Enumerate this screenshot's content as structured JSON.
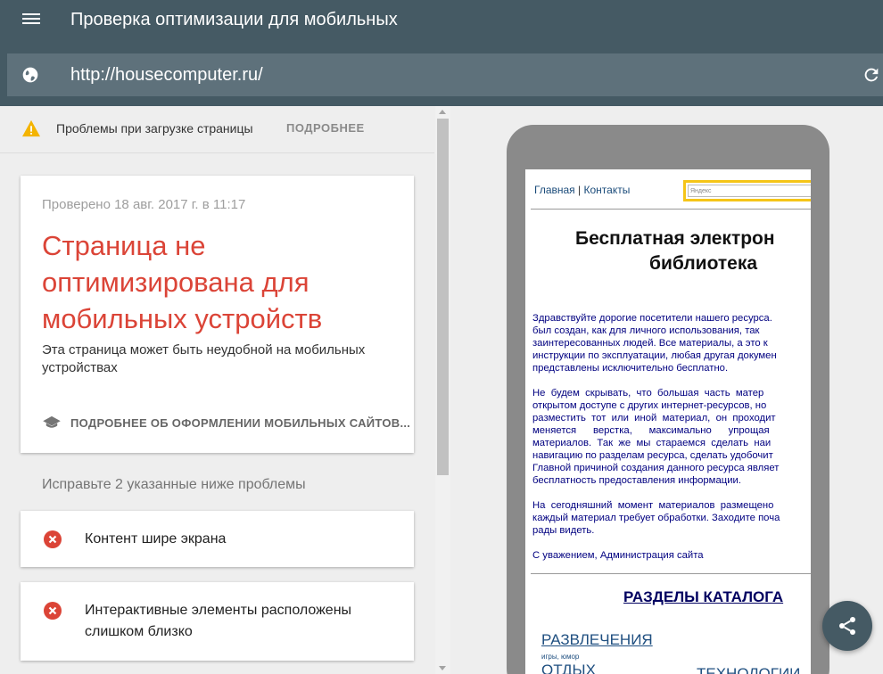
{
  "app": {
    "title": "Проверка оптимизации для мобильных",
    "menu_icon": "menu-icon"
  },
  "urlbar": {
    "value": "http://housecomputer.ru/",
    "globe_icon": "globe-icon",
    "reload_icon": "reload-icon"
  },
  "warning": {
    "icon": "warning-icon",
    "text": "Проблемы при загрузке страницы",
    "more": "ПОДРОБНЕЕ"
  },
  "result": {
    "checked": "Проверено 18 авг. 2017 г. в 11:17",
    "verdict": "Страница не оптимизирована для мобильных устройств",
    "subtitle": "Эта страница может быть неудобной на мобильных устройствах",
    "learn_more": "ПОДРОБНЕЕ ОБ ОФОРМЛЕНИИ МОБИЛЬНЫХ САЙТОВ...",
    "learn_icon": "school-icon",
    "colors": {
      "verdict": "#db4437",
      "topbar": "#455a64"
    }
  },
  "issues": {
    "title": "Исправьте 2 указанные ниже проблемы",
    "items": [
      {
        "label": "Контент шире экрана",
        "icon": "error-icon"
      },
      {
        "label": "Интерактивные элементы расположены слишком близко",
        "icon": "error-icon"
      }
    ]
  },
  "preview": {
    "nav_home": "Главная",
    "nav_sep": "|",
    "nav_contacts": "Контакты",
    "search_brand": "Яндекс",
    "title_line1": "Бесплатная электрон",
    "title_line2": "библиотека",
    "para1": "Здравствуйте дорогие посетители нашего ресурса.\nбыл создан, как для личного использования, так\nзаинтересованных людей. Все материалы, а это к\nинструкции по эксплуатации, любая другая докумен\nпредставлены исключительно бесплатно.",
    "para2": "Не  будем  скрывать,  что  большая  часть  матер\nоткрытом доступе с других интернет-ресурсов, но\nразместить  тот  или  иной  материал,  он  проходит\nменяется      верстка,      максимально      упрощая\nматериалов.  Так  же  мы  стараемся  сделать  наи\nнавигацию по разделам ресурса, сделать удобочит\nГлавной причиной создания данного ресурса являет\nбесплатность предоставления информации.",
    "para3": "На  сегодняшний  момент  материалов  размещено\nкаждый материал требует обработки. Заходите поча\nрады видеть.",
    "para4": "С уважением, Администрация сайта",
    "catalog": "РАЗДЕЛЫ КАТАЛОГА",
    "cat_fun": "РАЗВЛЕЧЕНИЯ",
    "cat_fun_sub": "игры, юмор",
    "cat_rest": "ОТДЫХ",
    "cat_tech": "ТЕХНОЛОГИИ"
  },
  "share": {
    "icon": "share-icon"
  }
}
